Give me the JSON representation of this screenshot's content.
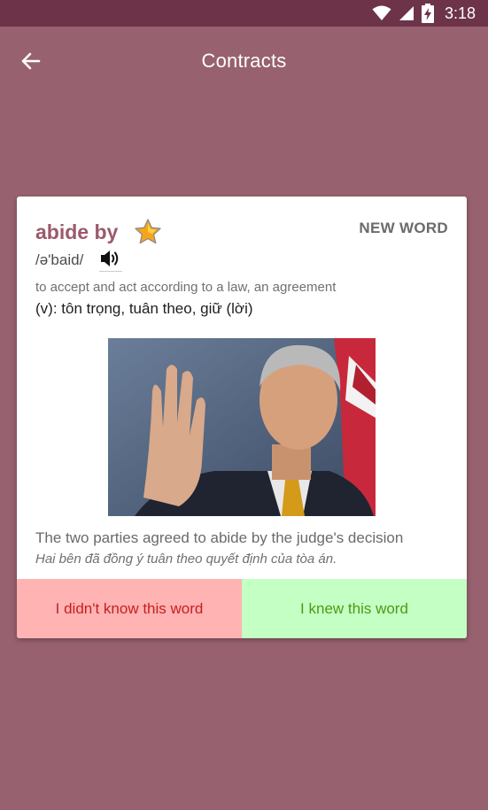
{
  "status_bar": {
    "time": "3:18"
  },
  "app_bar": {
    "title": "Contracts"
  },
  "card": {
    "word": "abide by",
    "badge": "NEW WORD",
    "phonetic": "/ə'baid/",
    "definition": "to accept and act according to a law, an agreement",
    "translation": "(v): tôn trọng, tuân theo, giữ (lời)",
    "example": "The two parties agreed to abide by the judge's decision",
    "example_translation": "Hai bên đã đồng ý tuân theo quyết định của tòa án."
  },
  "buttons": {
    "didnt_know": "I didn't know this word",
    "knew": "I knew this word"
  },
  "colors": {
    "background": "#98616f",
    "status_bar": "#6c3349",
    "word": "#9b5a6c",
    "didnt_know_bg": "#ffb3b3",
    "didnt_know_text": "#c81e1e",
    "knew_bg": "#c4ffc4",
    "knew_text": "#4d9a12"
  },
  "icons": [
    "wifi-icon",
    "signal-icon",
    "battery-charging-icon",
    "back-arrow-icon",
    "star-icon",
    "speaker-icon"
  ]
}
